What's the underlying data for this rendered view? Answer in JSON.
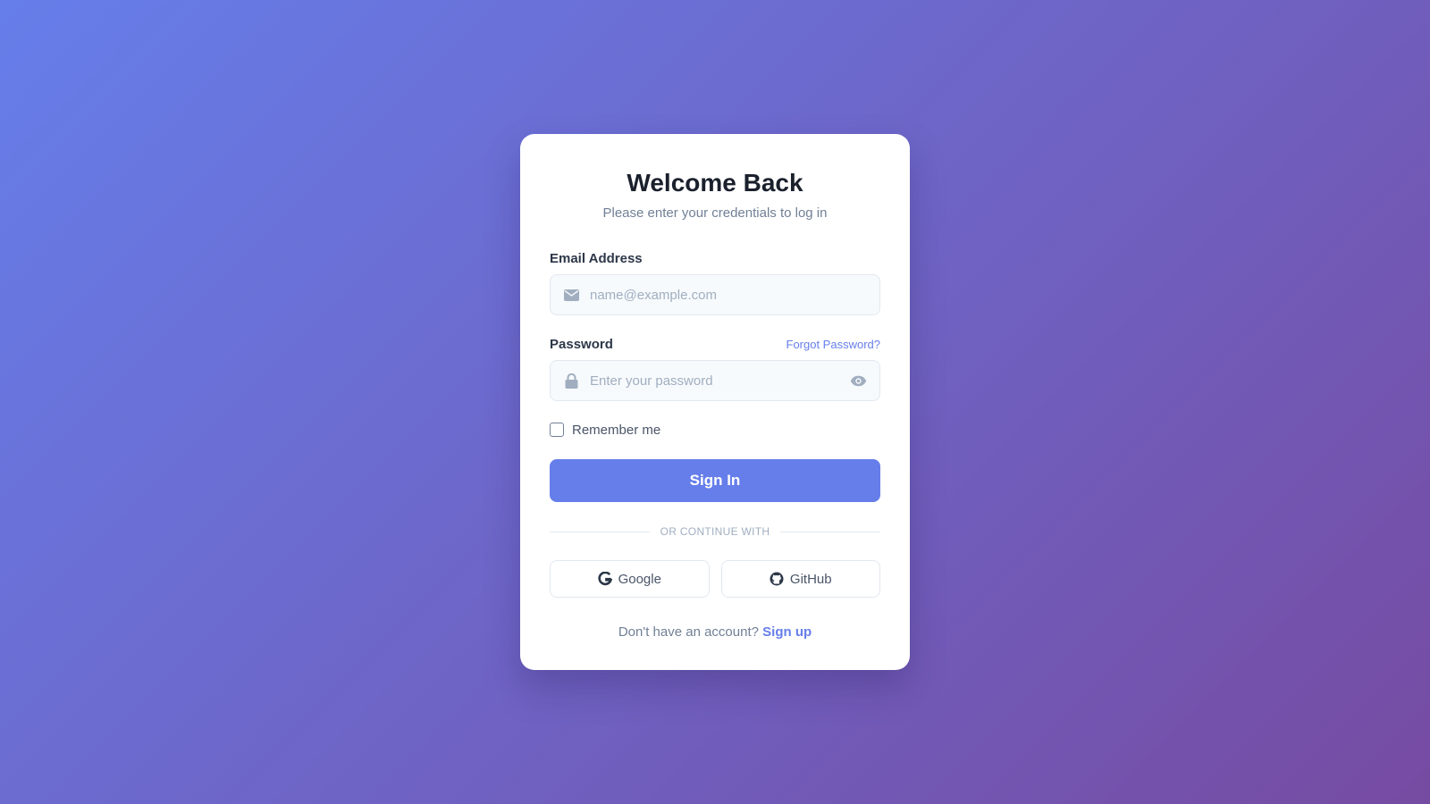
{
  "colors": {
    "gradient_start": "#667eea",
    "gradient_end": "#764ba2",
    "accent": "#667eea",
    "heading": "#1a202c",
    "muted": "#718096",
    "placeholder": "#a0aec0",
    "input_bg": "#f7fafc",
    "border": "#e2e8f0"
  },
  "login": {
    "title": "Welcome Back",
    "subtitle": "Please enter your credentials to log in",
    "email": {
      "label": "Email Address",
      "placeholder": "name@example.com",
      "value": "",
      "icon": "envelope-icon"
    },
    "password": {
      "label": "Password",
      "placeholder": "Enter your password",
      "value": "",
      "icon": "lock-icon",
      "toggle_icon": "eye-icon",
      "forgot_label": "Forgot Password?"
    },
    "remember_label": "Remember me",
    "remember_checked": false,
    "submit_label": "Sign In",
    "divider_text": "OR CONTINUE WITH",
    "social": [
      {
        "label": "Google",
        "icon": "google-icon"
      },
      {
        "label": "GitHub",
        "icon": "github-icon"
      }
    ],
    "footer_prompt": "Don't have an account?",
    "signup_label": "Sign up"
  }
}
